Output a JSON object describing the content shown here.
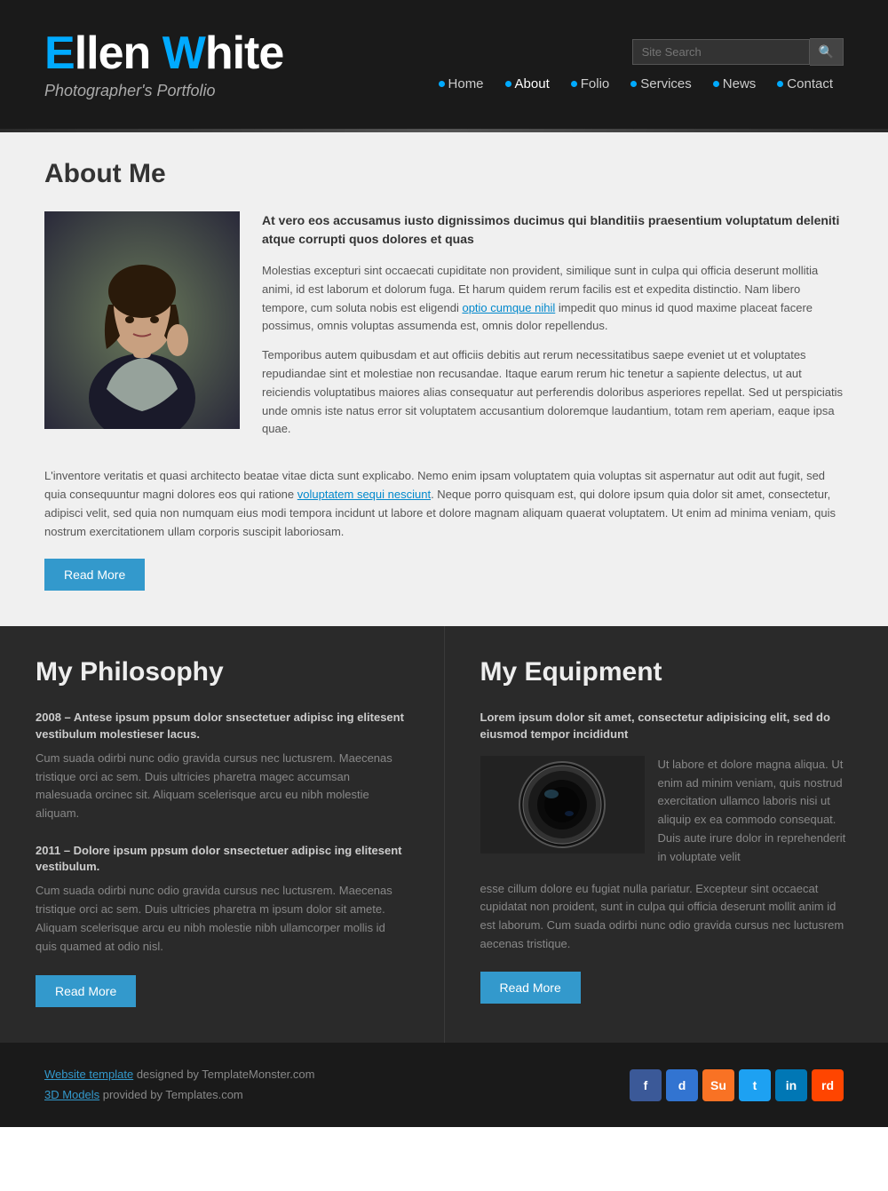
{
  "header": {
    "logo_e": "E",
    "logo_llen": "llen ",
    "logo_w": "W",
    "logo_hite": "hite",
    "logo_subtitle": "Photographer's Portfolio",
    "search_placeholder": "Site Search",
    "nav": [
      {
        "label": "Home",
        "active": false
      },
      {
        "label": "About",
        "active": true
      },
      {
        "label": "Folio",
        "active": false
      },
      {
        "label": "Services",
        "active": false
      },
      {
        "label": "News",
        "active": false
      },
      {
        "label": "Contact",
        "active": false
      }
    ]
  },
  "about": {
    "title": "About Me",
    "intro_bold": "At vero eos accusamus iusto dignissimos ducimus qui blanditiis praesentium voluptatum deleniti atque corrupti quos dolores et quas",
    "para1": "Molestias excepturi sint occaecati cupiditate non provident, similique sunt in culpa qui officia deserunt mollitia animi, id est laborum et dolorum fuga. Et harum quidem rerum facilis est et expedita distinctio. Nam libero tempore, cum soluta nobis est eligendi ",
    "link1_text": "optio cumque nihil",
    "link1_url": "#",
    "para1_cont": " impedit quo minus id quod maxime placeat facere possimus, omnis voluptas assumenda est, omnis dolor repellendus.",
    "para2": "Temporibus autem quibusdam et aut officiis debitis aut rerum necessitatibus saepe eveniet ut et voluptates repudiandae sint et molestiae non recusandae. Itaque earum rerum hic tenetur a sapiente delectus, ut aut reiciendis voluptatibus maiores alias consequatur aut perferendis doloribus asperiores repellat. Sed ut perspiciatis unde omnis iste natus error sit voluptatem accusantium doloremque laudantium, totam rem aperiam, eaque ipsa quae.",
    "full_text_pre": "L'inventore veritatis et quasi architecto beatae vitae dicta sunt explicabo. Nemo enim ipsam voluptatem quia voluptas sit aspernatur aut odit aut fugit, sed quia consequuntur magni dolores eos qui ratione ",
    "link2_text": "voluptatem sequi nesciunt",
    "link2_url": "#",
    "full_text_post": ". Neque porro quisquam est, qui dolore ipsum quia dolor sit amet, consectetur, adipisci velit, sed quia non numquam eius modi tempora incidunt ut labore et dolore magnam aliquam quaerat voluptatem. Ut enim ad minima veniam, quis nostrum exercitationem ullam corporis suscipit laboriosam.",
    "read_more": "Read More"
  },
  "philosophy": {
    "title": "My Philosophy",
    "items": [
      {
        "year": "2008 – Antese ipsum ppsum dolor snsectetuer adipisc ing elitesent vestibulum molestieser lacus.",
        "text": "Cum suada odirbi nunc odio gravida cursus nec luctusrem. Maecenas tristique orci ac sem. Duis ultricies pharetra magec accumsan malesuada orcinec sit. Aliquam scelerisque arcu eu nibh molestie aliquam."
      },
      {
        "year": "2011 – Dolore ipsum ppsum dolor snsectetuer adipisc ing elitesent vestibulum.",
        "text": "Cum suada odirbi nunc odio gravida cursus nec luctusrem. Maecenas tristique orci ac sem. Duis ultricies pharetra m ipsum dolor sit amete. Aliquam scelerisque arcu eu nibh molestie  nibh ullamcorper mollis id quis quamed at odio nisl."
      }
    ],
    "read_more": "Read More"
  },
  "equipment": {
    "title": "My Equipment",
    "subtitle": "Lorem ipsum dolor sit amet, consectetur adipisicing elit, sed do eiusmod tempor incididunt",
    "desc_right": "Ut labore et dolore magna aliqua. Ut enim ad minim veniam, quis nostrud exercitation ullamco laboris nisi ut aliquip ex ea commodo consequat. Duis aute irure dolor in reprehenderit in voluptate velit",
    "desc_full": "esse cillum dolore eu fugiat nulla pariatur. Excepteur sint occaecat cupidatat non proident, sunt in culpa qui officia deserunt mollit anim id est laborum. Cum suada odirbi nunc odio gravida cursus nec luctusrem aecenas tristique.",
    "read_more": "Read More"
  },
  "footer": {
    "template_text": "Website template",
    "designed_by": " designed by TemplateMonster.com",
    "models_text": "3D Models",
    "provided_by": " provided by Templates.com",
    "social": [
      {
        "name": "facebook",
        "label": "f",
        "class": "si-fb"
      },
      {
        "name": "delicious",
        "label": "d",
        "class": "si-del"
      },
      {
        "name": "stumbleupon",
        "label": "Su",
        "class": "si-su"
      },
      {
        "name": "twitter",
        "label": "t",
        "class": "si-tw"
      },
      {
        "name": "linkedin",
        "label": "in",
        "class": "si-li"
      },
      {
        "name": "reddit",
        "label": "rd",
        "class": "si-rd"
      }
    ]
  }
}
